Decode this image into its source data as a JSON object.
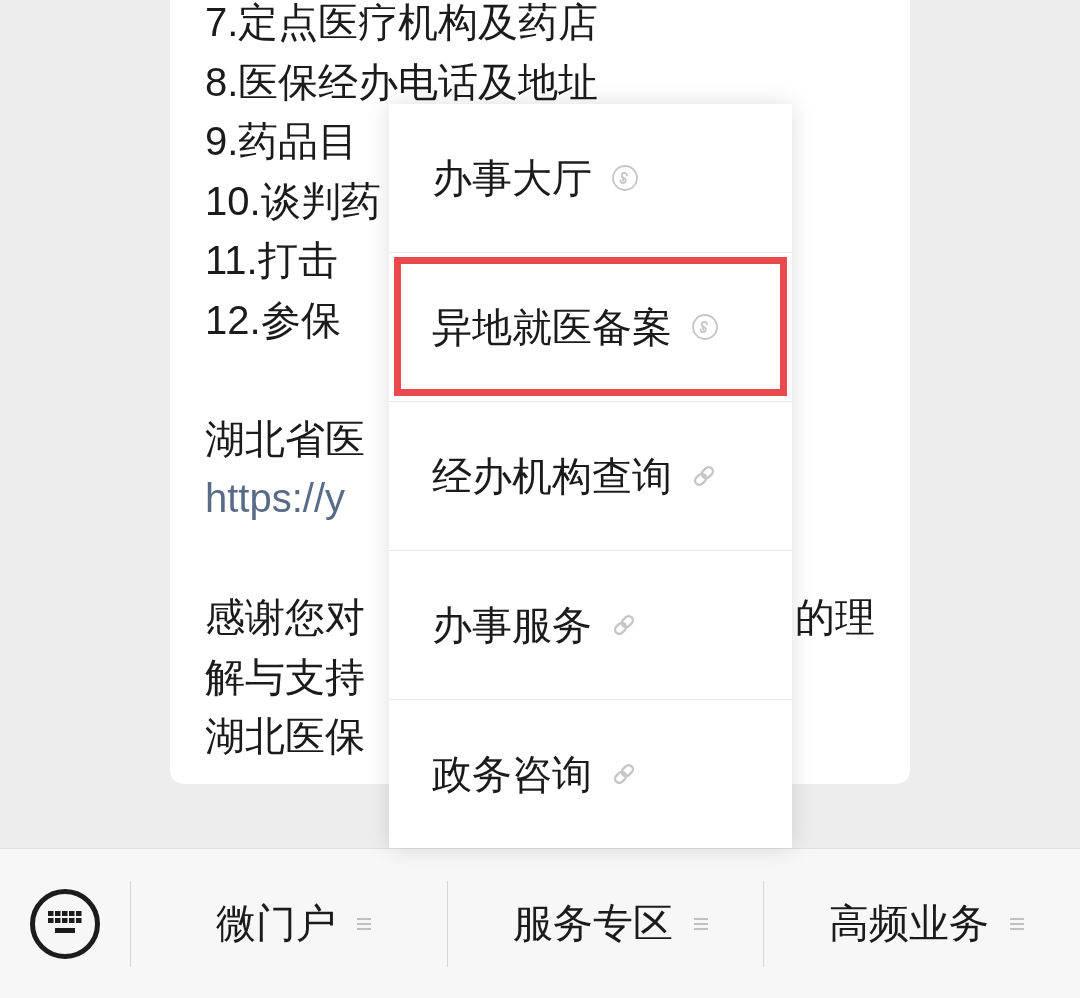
{
  "message": {
    "paragraphs": [
      {
        "lines": [
          {
            "kind": "text",
            "parts": [
              "7.定点医疗机构及药店"
            ]
          },
          {
            "kind": "text",
            "parts": [
              "8.医保经办电话及地址"
            ]
          },
          {
            "kind": "text",
            "parts": [
              "9.药品目"
            ]
          },
          {
            "kind": "text",
            "parts": [
              "10.谈判药"
            ]
          },
          {
            "kind": "text",
            "parts": [
              "11.打击"
            ]
          },
          {
            "kind": "text",
            "parts": [
              "12.参保"
            ]
          }
        ]
      },
      {
        "lines": [
          {
            "kind": "text",
            "parts": [
              "湖北省医"
            ]
          },
          {
            "kind": "link",
            "parts": [
              "https://y"
            ]
          }
        ]
      },
      {
        "lines": [
          {
            "kind": "text",
            "parts": [
              "感谢您对",
              "的理"
            ]
          },
          {
            "kind": "text",
            "parts": [
              "解与支持"
            ]
          },
          {
            "kind": "text",
            "parts": [
              "湖北医保"
            ]
          }
        ]
      }
    ]
  },
  "popup_menu": {
    "items": [
      {
        "label": "办事大厅",
        "kind": "mini_program",
        "highlighted": false
      },
      {
        "label": "异地就医备案",
        "kind": "mini_program",
        "highlighted": true
      },
      {
        "label": "经办机构查询",
        "kind": "link",
        "highlighted": false
      },
      {
        "label": "办事服务",
        "kind": "link",
        "highlighted": false
      },
      {
        "label": "政务咨询",
        "kind": "link",
        "highlighted": false
      }
    ]
  },
  "bottom_bar": {
    "tabs": [
      {
        "label": "微门户"
      },
      {
        "label": "服务专区"
      },
      {
        "label": "高频业务"
      }
    ]
  }
}
